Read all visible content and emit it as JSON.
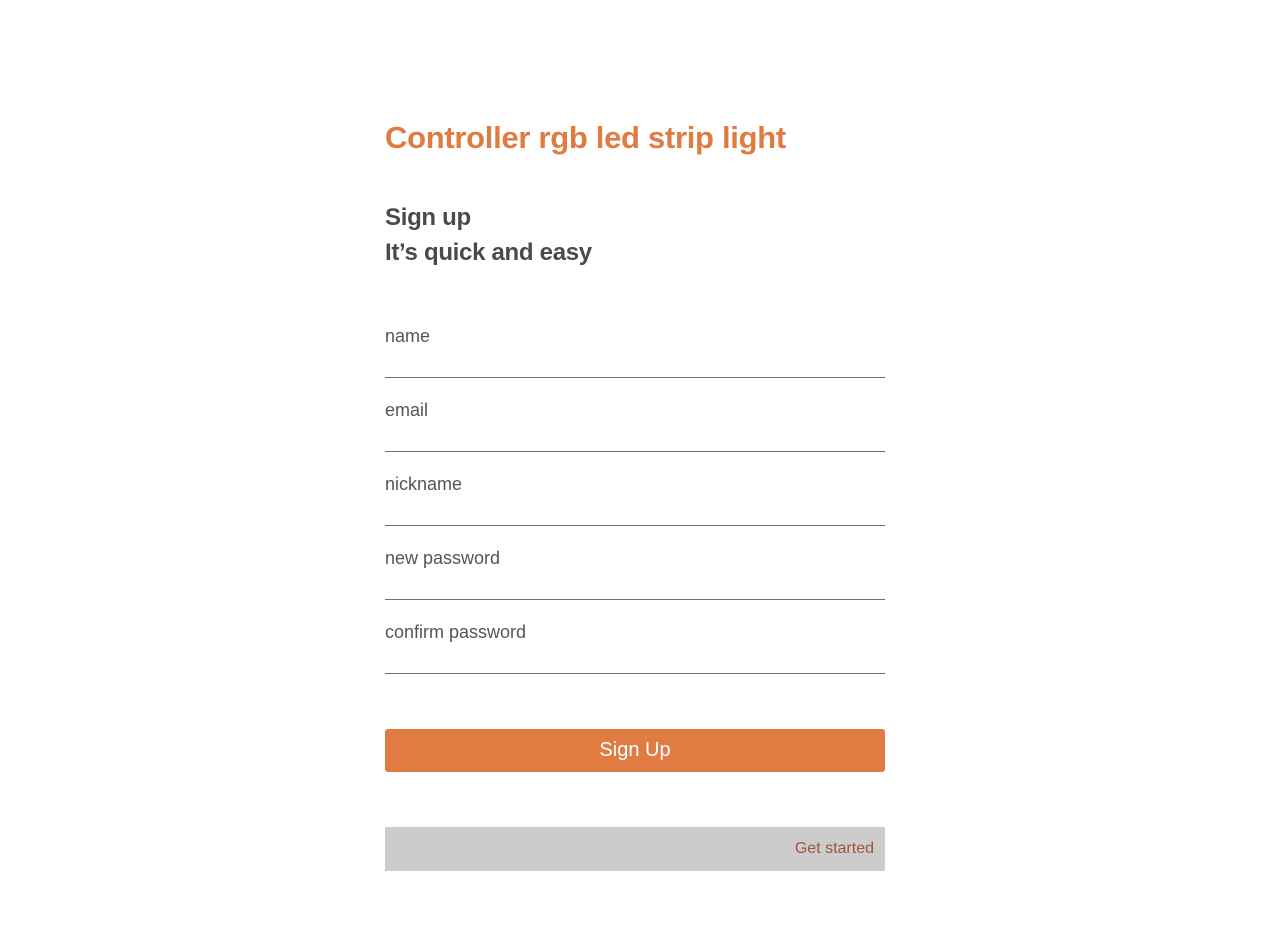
{
  "app": {
    "title": "Controller rgb led strip light"
  },
  "form": {
    "heading_line1": "Sign up",
    "heading_line2": "It’s quick and easy",
    "fields": [
      {
        "label": "name",
        "value": ""
      },
      {
        "label": "email",
        "value": ""
      },
      {
        "label": "nickname",
        "value": ""
      },
      {
        "label": "new password",
        "value": ""
      },
      {
        "label": "confirm password",
        "value": ""
      }
    ],
    "submit_label": "Sign Up"
  },
  "footer": {
    "link_label": "Get started"
  },
  "colors": {
    "accent": "#e07b42",
    "heading": "#4a4a4a",
    "footer_bg": "#cccccc",
    "link": "#a0553a"
  }
}
